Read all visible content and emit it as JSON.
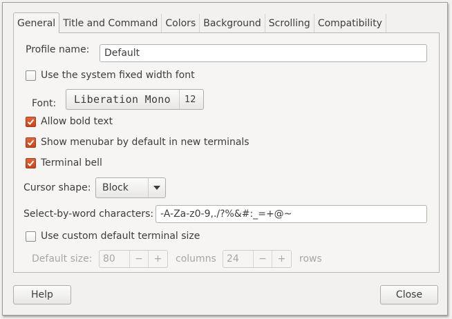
{
  "tabs": [
    {
      "label": "General",
      "active": true
    },
    {
      "label": "Title and Command",
      "active": false
    },
    {
      "label": "Colors",
      "active": false
    },
    {
      "label": "Background",
      "active": false
    },
    {
      "label": "Scrolling",
      "active": false
    },
    {
      "label": "Compatibility",
      "active": false
    }
  ],
  "general": {
    "profile_name_label": "Profile name:",
    "profile_name_value": "Default",
    "fixed_font_label": "Use the system fixed width font",
    "fixed_font_checked": false,
    "font_label": "Font:",
    "font_name": "Liberation Mono",
    "font_size": "12",
    "bold_label": "Allow bold text",
    "bold_checked": true,
    "menubar_label": "Show menubar by default in new terminals",
    "menubar_checked": true,
    "bell_label": "Terminal bell",
    "bell_checked": true,
    "cursor_shape_label": "Cursor shape:",
    "cursor_shape_value": "Block",
    "word_chars_label": "Select-by-word characters:",
    "word_chars_value": "-A-Za-z0-9,./?%&#:_=+@~",
    "custom_size_label": "Use custom default terminal size",
    "custom_size_checked": false,
    "default_size_label": "Default size:",
    "columns_value": "80",
    "columns_label": "columns",
    "rows_value": "24",
    "rows_label": "rows",
    "minus_symbol": "−",
    "plus_symbol": "+"
  },
  "footer": {
    "help_label": "Help",
    "close_label": "Close"
  },
  "colors": {
    "accent": "#dd5a2c",
    "disabled_text": "#a9a6a2"
  }
}
